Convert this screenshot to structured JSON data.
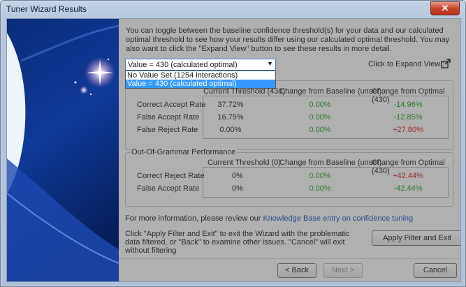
{
  "window": {
    "title": "Tuner Wizard Results",
    "close_glyph": "✕"
  },
  "intro": "You can toggle between the baseline confidence threshold(s) for your data and our calculated optimal threshold to see how your results differ using our calculated optimal threshold. You may also want to click the \"Expand View\" button to see these results in more detail.",
  "dropdown": {
    "selected": "Value = 430   (calculated optimal)",
    "options": [
      "No Value Set  (1254 interactions)",
      "Value = 430   (calculated optimal)"
    ],
    "highlighted_index": 1
  },
  "expand": {
    "label": "Click to Expand View :",
    "icon": "external-link-icon"
  },
  "in_grammar": {
    "headers": [
      "Current Threshold (430)",
      "Change from Baseline (unset)",
      "Change from Optimal (430)"
    ],
    "rows": [
      {
        "label": "Correct Accept Rate",
        "current": "37.72%",
        "baseline": "0.00%",
        "optimal": "-14.96%",
        "optimal_color": "green"
      },
      {
        "label": "False Accept Rate",
        "current": "16.75%",
        "baseline": "0.00%",
        "optimal": "-12.85%",
        "optimal_color": "green"
      },
      {
        "label": "False Reject Rate",
        "current": "0.00%",
        "baseline": "0.00%",
        "optimal": "+27.80%",
        "optimal_color": "red"
      }
    ]
  },
  "oog": {
    "title": "Out-Of-Grammar Performance",
    "headers": [
      "Current Threshold (0)",
      "Change from Baseline (unset)",
      "Change from Optimal (430)"
    ],
    "rows": [
      {
        "label": "Correct Reject Rate",
        "current": "0%",
        "baseline": "0.00%",
        "optimal": "+42.44%",
        "optimal_color": "red"
      },
      {
        "label": "False Accept Rate",
        "current": "0%",
        "baseline": "0.00%",
        "optimal": "-42.44%",
        "optimal_color": "green"
      }
    ]
  },
  "info": {
    "text": "For more information, please review our ",
    "link": "Knowledge Base entry on confidence tuning"
  },
  "instructions": "Click \"Apply Filter and Exit\" to exit the Wizard with the problematic data filtered, or \"Back\" to examine other issues. \"Cancel\" will exit without filtering",
  "buttons": {
    "apply": "Apply Filter and Exit",
    "back": "< Back",
    "next": "Next >",
    "cancel": "Cancel"
  },
  "colors": {
    "green": "#1f9a1f",
    "red": "#d01818",
    "link": "#1b4fb3",
    "accent": "#3399ff"
  }
}
